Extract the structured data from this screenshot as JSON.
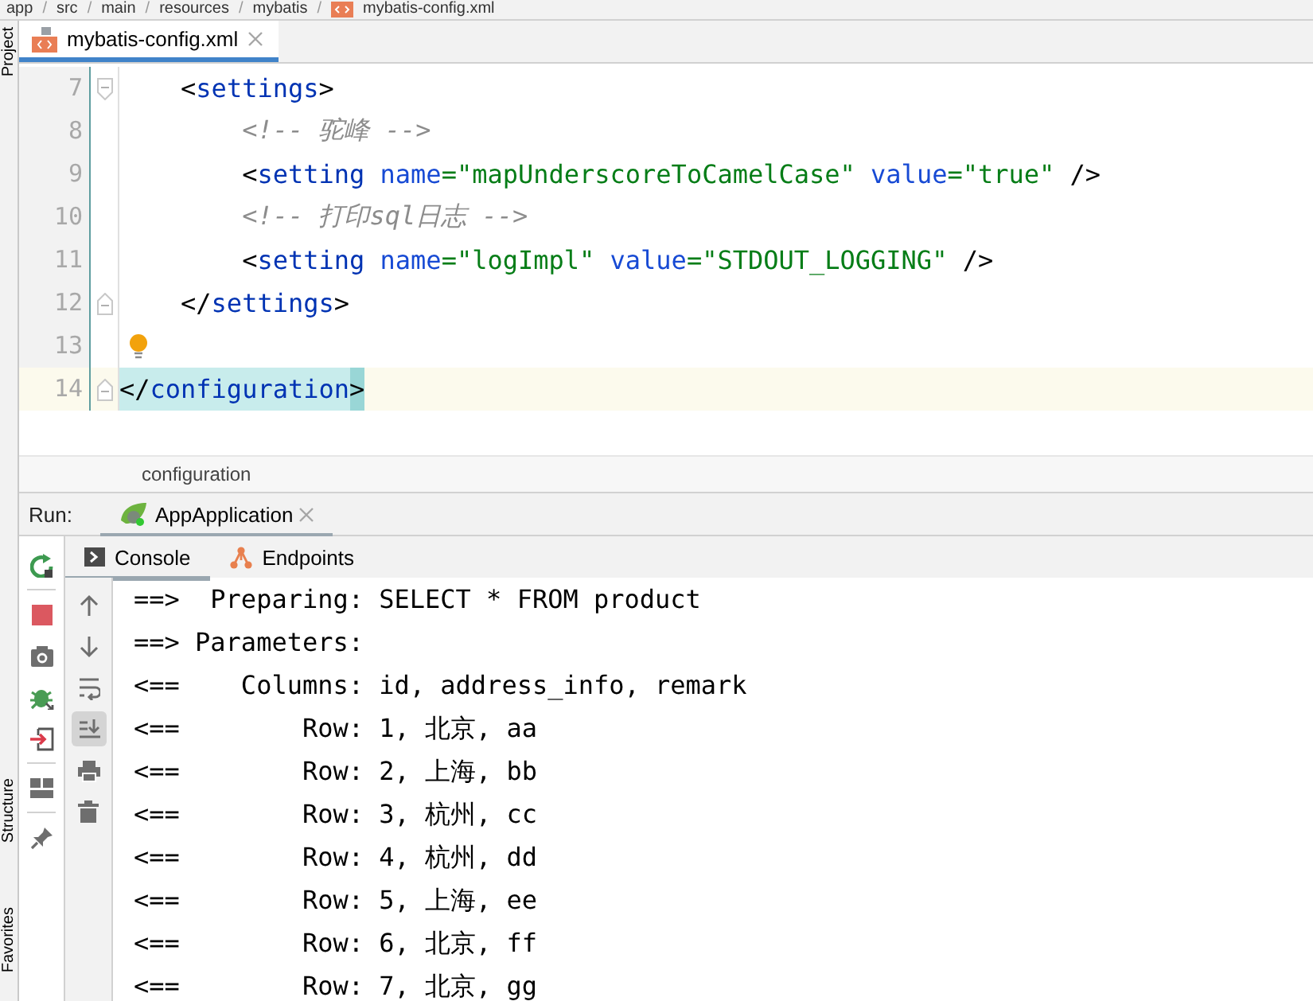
{
  "breadcrumb": [
    {
      "label": "app",
      "separator": "/"
    },
    {
      "label": "src",
      "separator": "/"
    },
    {
      "label": "main",
      "separator": "/"
    },
    {
      "label": "resources",
      "separator": "/"
    },
    {
      "label": "mybatis",
      "separator": "/"
    },
    {
      "label": "mybatis-config.xml"
    }
  ],
  "side_tools_top": [
    "Project"
  ],
  "side_tools_bottom": [
    "Structure",
    "Favorites"
  ],
  "editor_tabs": [
    {
      "label": "mybatis-config.xml",
      "selected": true
    }
  ],
  "code_lines": [
    {
      "number": "7",
      "fold_start": true,
      "fold_end": false,
      "current": false,
      "hint": false,
      "segments": [
        {
          "kind": "punct",
          "text": "    <"
        },
        {
          "kind": "tag",
          "text": "settings"
        },
        {
          "kind": "punct",
          "text": ">"
        }
      ]
    },
    {
      "number": "8",
      "fold_start": false,
      "fold_end": false,
      "current": false,
      "hint": false,
      "segments": [
        {
          "kind": "comment",
          "text": "        <!-- 驼峰 -->"
        }
      ]
    },
    {
      "number": "9",
      "fold_start": false,
      "fold_end": false,
      "current": false,
      "hint": false,
      "segments": [
        {
          "kind": "punct",
          "text": "        <"
        },
        {
          "kind": "tag",
          "text": "setting"
        },
        {
          "kind": "attr",
          "text": " name"
        },
        {
          "kind": "string",
          "text": "=\"mapUnderscoreToCamelCase\""
        },
        {
          "kind": "attr",
          "text": " value"
        },
        {
          "kind": "string",
          "text": "=\"true\""
        },
        {
          "kind": "punct",
          "text": " />"
        }
      ]
    },
    {
      "number": "10",
      "fold_start": false,
      "fold_end": false,
      "current": false,
      "hint": false,
      "segments": [
        {
          "kind": "comment",
          "text": "        <!-- 打印sql日志 -->"
        }
      ]
    },
    {
      "number": "11",
      "fold_start": false,
      "fold_end": false,
      "current": false,
      "hint": false,
      "segments": [
        {
          "kind": "punct",
          "text": "        <"
        },
        {
          "kind": "tag",
          "text": "setting"
        },
        {
          "kind": "attr",
          "text": " name"
        },
        {
          "kind": "string",
          "text": "=\"logImpl\""
        },
        {
          "kind": "attr",
          "text": " value"
        },
        {
          "kind": "string",
          "text": "=\"STDOUT_LOGGING\""
        },
        {
          "kind": "punct",
          "text": " />"
        }
      ]
    },
    {
      "number": "12",
      "fold_start": false,
      "fold_end": true,
      "current": false,
      "hint": false,
      "segments": [
        {
          "kind": "punct",
          "text": "    </"
        },
        {
          "kind": "tag",
          "text": "settings"
        },
        {
          "kind": "punct",
          "text": ">"
        }
      ]
    },
    {
      "number": "13",
      "fold_start": false,
      "fold_end": false,
      "current": false,
      "hint": true
    },
    {
      "number": "14",
      "fold_start": false,
      "fold_end": true,
      "current": true,
      "hint": false,
      "segments": [
        {
          "kind": "match_punct",
          "text": "</"
        },
        {
          "kind": "match_tag",
          "text": "configuration"
        },
        {
          "kind": "match_brace",
          "text": ">"
        }
      ]
    }
  ],
  "editor_breadcrumb": "configuration",
  "run_bar": {
    "label": "Run:",
    "tabs": [
      {
        "label": "AppApplication",
        "selected": true
      }
    ]
  },
  "console_tabs": [
    {
      "label": "Console",
      "selected": true
    },
    {
      "label": "Endpoints",
      "selected": false
    }
  ],
  "console_tools": [
    {
      "kind": "up",
      "active": false
    },
    {
      "kind": "down",
      "active": false
    },
    {
      "kind": "wrap",
      "active": false
    },
    {
      "kind": "scroll-end",
      "active": true
    },
    {
      "kind": "print",
      "active": false
    },
    {
      "kind": "trash",
      "active": false
    }
  ],
  "console_lines": [
    "==>  Preparing: SELECT * FROM product",
    "==> Parameters: ",
    "<==    Columns: id, address_info, remark",
    "<==        Row: 1, 北京, aa",
    "<==        Row: 2, 上海, bb",
    "<==        Row: 3, 杭州, cc",
    "<==        Row: 4, 杭州, dd",
    "<==        Row: 5, 上海, ee",
    "<==        Row: 6, 北京, ff",
    "<==        Row: 7, 北京, gg"
  ]
}
